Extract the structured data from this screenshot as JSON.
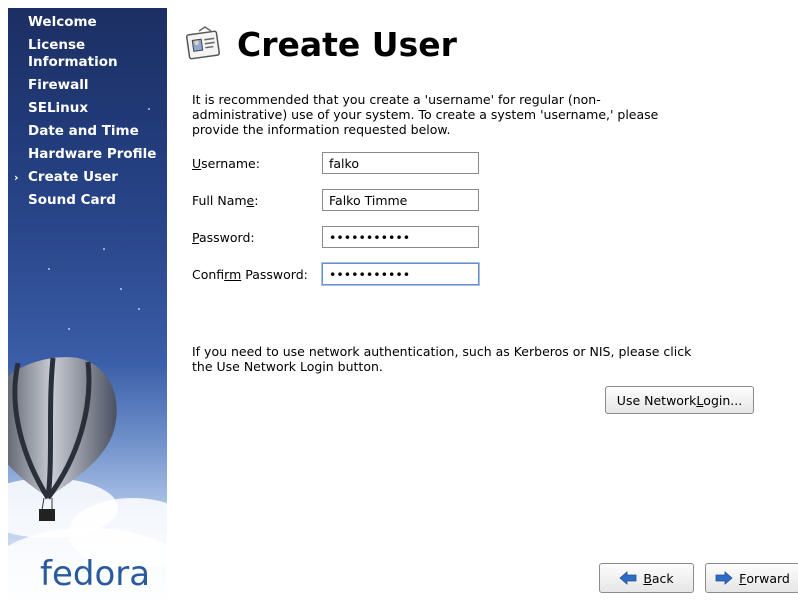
{
  "sidebar": {
    "items": [
      {
        "label": "Welcome",
        "current": false
      },
      {
        "label": "License Information",
        "current": false
      },
      {
        "label": "Firewall",
        "current": false
      },
      {
        "label": "SELinux",
        "current": false
      },
      {
        "label": "Date and Time",
        "current": false
      },
      {
        "label": "Hardware Profile",
        "current": false
      },
      {
        "label": "Create User",
        "current": true
      },
      {
        "label": "Sound Card",
        "current": false
      }
    ],
    "logo_text": "fedora"
  },
  "page": {
    "title": "Create User",
    "description": "It is recommended that you create a 'username' for regular (non-administrative) use of your system. To create a system 'username,' please provide the information requested below."
  },
  "form": {
    "username": {
      "label_before": "",
      "label_mnemonic": "U",
      "label_after": "sername:",
      "value": "falko"
    },
    "fullname": {
      "label_before": "Full Nam",
      "label_mnemonic": "e",
      "label_after": ":",
      "value": "Falko Timme"
    },
    "password": {
      "label_before": "",
      "label_mnemonic": "P",
      "label_after": "assword:",
      "value": "•••••••••••"
    },
    "confirm": {
      "label_before": "Confi",
      "label_mnemonic": "rm",
      "label_after": " Password:",
      "value": "•••••••••••"
    }
  },
  "network": {
    "text": "If you need to use network authentication, such as Kerberos or NIS, please click the Use Network Login button.",
    "button_before": "Use Network ",
    "button_mnemonic": "L",
    "button_after": "ogin..."
  },
  "nav_buttons": {
    "back_mnemonic": "B",
    "back_rest": "ack",
    "forward_mnemonic": "F",
    "forward_rest": "orward"
  },
  "icons": {
    "arrow_color": "#2e6bc6",
    "back": "left-arrow-icon",
    "forward": "right-arrow-icon",
    "title": "user-card-icon",
    "current_marker": "triangle-right-icon"
  }
}
